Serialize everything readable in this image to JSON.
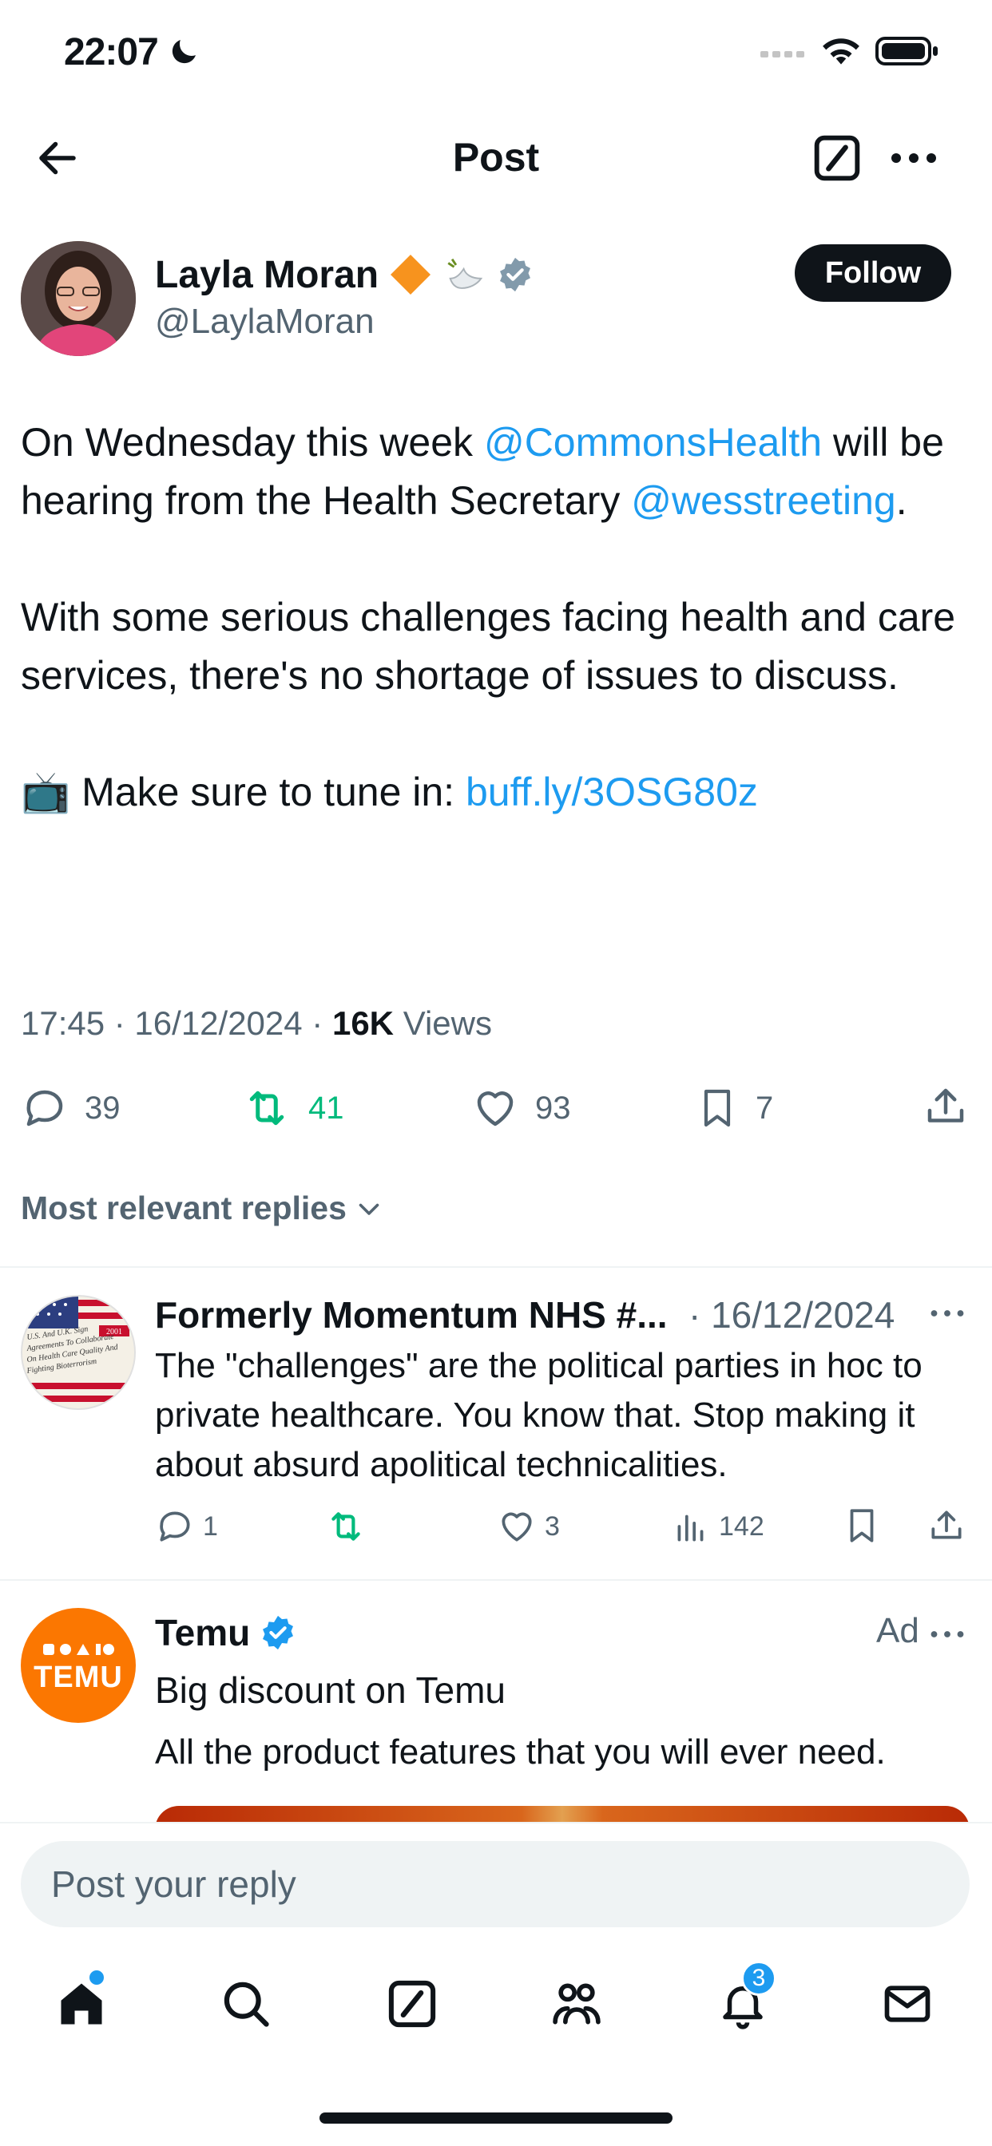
{
  "status": {
    "time": "22:07"
  },
  "header": {
    "title": "Post"
  },
  "post": {
    "author_name": "Layla Moran",
    "author_handle": "@LaylaMoran",
    "follow_label": "Follow",
    "para1": {
      "t1": "On Wednesday this week ",
      "m1": "@CommonsHealth",
      "t2": " will be hearing from the Health Secretary ",
      "m2": "@wesstreeting",
      "t3": "."
    },
    "para2": "With some serious challenges facing health and care services, there's no shortage of issues to discuss.",
    "para3": {
      "emoji": "📺",
      "text": " Make sure to tune in: ",
      "link": "buff.ly/3OSG80z"
    },
    "timestamp": "17:45 · 16/12/2024 · ",
    "views_count": "16K",
    "views_label": " Views",
    "stats": {
      "replies": "39",
      "reposts": "41",
      "likes": "93",
      "bookmarks": "7"
    },
    "accent": "#1d9bf0",
    "repost_color": "#00ba7c"
  },
  "replies_header": "Most relevant replies",
  "reply": {
    "name": "Formerly Momentum NHS #...",
    "date": "· 16/12/2024",
    "text": "The \"challenges\" are the political parties in hoc to private healthcare. You know that. Stop making it about absurd apolitical technicalities.",
    "stats": {
      "replies": "1",
      "reposts": "",
      "likes": "3",
      "views": "142"
    },
    "avatar_lines": [
      "U.S. And U.K. Sign",
      "Agreements To Collaborate",
      "On Health Care Quality And",
      "Fighting Bioterrorism"
    ],
    "avatar_badge": "2001"
  },
  "ad": {
    "name": "Temu",
    "label": "Ad",
    "title": "Big discount on Temu",
    "body": "All the product features that you will ever need.",
    "logo_text": "TEMU",
    "brand_color": "#fb7701"
  },
  "composer": {
    "placeholder": "Post your reply"
  },
  "tabbar": {
    "notifications_badge": "3"
  }
}
